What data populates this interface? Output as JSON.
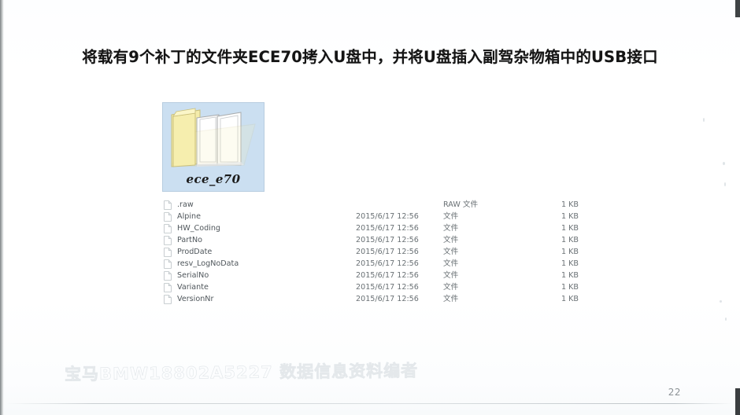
{
  "slide": {
    "title": "将载有9个补丁的文件夹ECE70拷入U盘中，并将U盘插入副驾杂物箱中的USB接口",
    "page_number": "22",
    "watermark": "宝马BMW18802A5227 数据信息资料编者"
  },
  "folder": {
    "label": "ece_e70",
    "icon": "open-folder-icon",
    "selection_color": "#cbdff1",
    "folder_color": "#f5eeb0"
  },
  "file_list": {
    "icon": "file-document-icon",
    "rows": [
      {
        "name": ".raw",
        "date": "",
        "type": "RAW 文件",
        "size": "1 KB"
      },
      {
        "name": "Alpine",
        "date": "2015/6/17 12:56",
        "type": "文件",
        "size": "1 KB"
      },
      {
        "name": "HW_Coding",
        "date": "2015/6/17 12:56",
        "type": "文件",
        "size": "1 KB"
      },
      {
        "name": "PartNo",
        "date": "2015/6/17 12:56",
        "type": "文件",
        "size": "1 KB"
      },
      {
        "name": "ProdDate",
        "date": "2015/6/17 12:56",
        "type": "文件",
        "size": "1 KB"
      },
      {
        "name": "resv_LogNoData",
        "date": "2015/6/17 12:56",
        "type": "文件",
        "size": "1 KB"
      },
      {
        "name": "SerialNo",
        "date": "2015/6/17 12:56",
        "type": "文件",
        "size": "1 KB"
      },
      {
        "name": "Variante",
        "date": "2015/6/17 12:56",
        "type": "文件",
        "size": "1 KB"
      },
      {
        "name": "VersionNr",
        "date": "2015/6/17 12:56",
        "type": "文件",
        "size": "1 KB"
      }
    ]
  }
}
